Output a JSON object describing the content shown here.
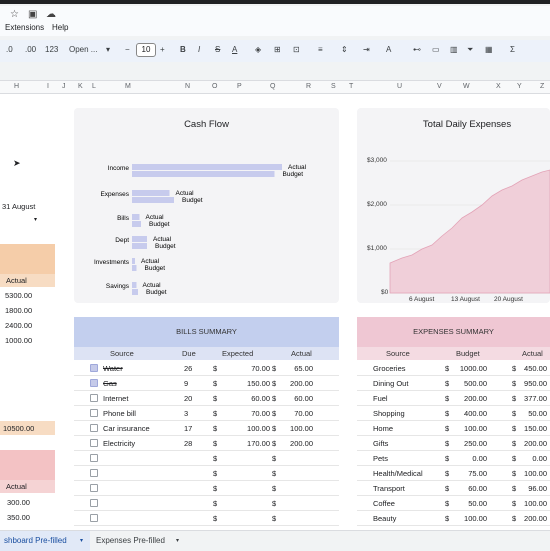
{
  "menu": [
    "Extensions",
    "Help"
  ],
  "toolbar": {
    "zoom_a": ".0",
    "zoom_b": ".00",
    "format": "123",
    "font": "Open ...",
    "font_size": "10"
  },
  "columns": [
    "H",
    "I",
    "J",
    "K",
    "L",
    "M",
    "N",
    "O",
    "P",
    "Q",
    "R",
    "S",
    "T",
    "U",
    "V",
    "W",
    "X",
    "Y",
    "Z"
  ],
  "cashflow": {
    "title": "Cash Flow",
    "rows": [
      {
        "label": "Income",
        "actual": 1.0,
        "budget": 0.95
      },
      {
        "label": "Expenses",
        "actual": 0.25,
        "budget": 0.28
      },
      {
        "label": "Bills",
        "actual": 0.05,
        "budget": 0.06
      },
      {
        "label": "Dept",
        "actual": 0.1,
        "budget": 0.1
      },
      {
        "label": "Investments",
        "actual": 0.02,
        "budget": 0.03
      },
      {
        "label": "Savings",
        "actual": 0.03,
        "budget": 0.04
      }
    ],
    "actual_label": "Actual",
    "budget_label": "Budget"
  },
  "daily": {
    "title": "Total Daily Expenses",
    "yticks": [
      "$3,000",
      "$2,000",
      "$1,000",
      "$0"
    ],
    "xticks": [
      "6 August",
      "13 August",
      "20 August"
    ]
  },
  "left": {
    "date": "31 August",
    "actual_header": "Actual",
    "values": [
      "5300.00",
      "1800.00",
      "2400.00",
      "1000.00"
    ],
    "total": "10500.00",
    "actual_header2": "Actual",
    "values2": [
      "300.00",
      "350.00"
    ]
  },
  "bills": {
    "title": "BILLS SUMMARY",
    "headers": [
      "Source",
      "Due",
      "Expected",
      "Actual"
    ],
    "rows": [
      {
        "checked": true,
        "source": "Water",
        "due": "26",
        "exp": "70.00",
        "act": "65.00",
        "struck": true
      },
      {
        "checked": true,
        "source": "Gas",
        "due": "9",
        "exp": "150.00",
        "act": "200.00",
        "struck": true
      },
      {
        "checked": false,
        "source": "Internet",
        "due": "20",
        "exp": "60.00",
        "act": "60.00",
        "struck": false
      },
      {
        "checked": false,
        "source": "Phone bill",
        "due": "3",
        "exp": "70.00",
        "act": "70.00",
        "struck": false
      },
      {
        "checked": false,
        "source": "Car insurance",
        "due": "17",
        "exp": "100.00",
        "act": "100.00",
        "struck": false
      },
      {
        "checked": false,
        "source": "Electricity",
        "due": "28",
        "exp": "170.00",
        "act": "200.00",
        "struck": false
      },
      {
        "checked": false,
        "source": "",
        "due": "",
        "exp": "",
        "act": "",
        "struck": false
      },
      {
        "checked": false,
        "source": "",
        "due": "",
        "exp": "",
        "act": "",
        "struck": false
      },
      {
        "checked": false,
        "source": "",
        "due": "",
        "exp": "",
        "act": "",
        "struck": false
      },
      {
        "checked": false,
        "source": "",
        "due": "",
        "exp": "",
        "act": "",
        "struck": false
      },
      {
        "checked": false,
        "source": "",
        "due": "",
        "exp": "",
        "act": "",
        "struck": false
      }
    ],
    "currency": "$"
  },
  "expenses": {
    "title": "EXPENSES SUMMARY",
    "headers": [
      "Source",
      "Budget",
      "Actual"
    ],
    "rows": [
      {
        "source": "Groceries",
        "budget": "1000.00",
        "act": "450.00"
      },
      {
        "source": "Dining Out",
        "budget": "500.00",
        "act": "950.00"
      },
      {
        "source": "Fuel",
        "budget": "200.00",
        "act": "377.00"
      },
      {
        "source": "Shopping",
        "budget": "400.00",
        "act": "50.00"
      },
      {
        "source": "Home",
        "budget": "100.00",
        "act": "150.00"
      },
      {
        "source": "Gifts",
        "budget": "250.00",
        "act": "200.00"
      },
      {
        "source": "Pets",
        "budget": "0.00",
        "act": "0.00"
      },
      {
        "source": "Health/Medical",
        "budget": "75.00",
        "act": "100.00"
      },
      {
        "source": "Transport",
        "budget": "60.00",
        "act": "96.00"
      },
      {
        "source": "Coffee",
        "budget": "50.00",
        "act": "100.00"
      },
      {
        "source": "Beauty",
        "budget": "100.00",
        "act": "200.00"
      }
    ],
    "currency": "$"
  },
  "tabs": [
    "shboard Pre-filled",
    "Expenses Pre-filled"
  ],
  "colors": {
    "bills_header": "#c3cfee",
    "expenses_header": "#efc7d3",
    "bar": "#c7cbed",
    "orange": "#f5cda9",
    "pink": "#f3c2c4"
  }
}
